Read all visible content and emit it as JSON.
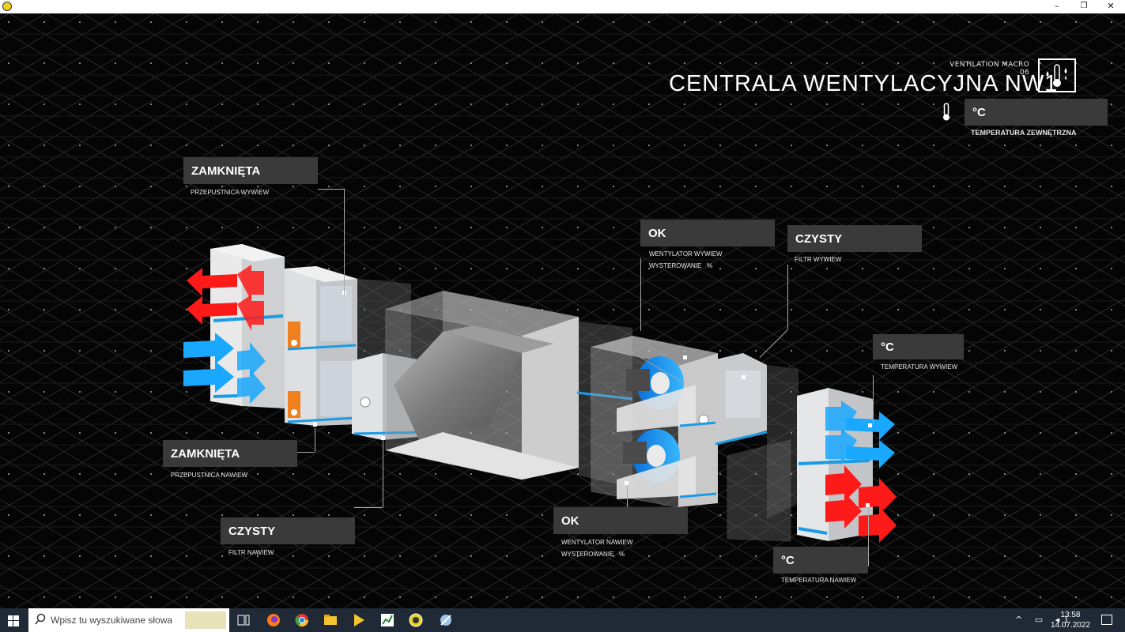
{
  "window": {
    "minimize": "–",
    "restore": "❐",
    "close": "✕"
  },
  "header": {
    "subtitle": "VENTILATION MACRO 06",
    "title": "CENTRALA WENTYLACYJNA NW1",
    "icon": "thermometer-droplets-icon"
  },
  "outdoor": {
    "value": "°C",
    "label": "TEMPERATURA ZEWNĘTRZNA",
    "icon": "thermometer-icon"
  },
  "labels": {
    "damper_exhaust": {
      "value": "ZAMKNIĘTA",
      "label": "PRZEPUSTNICA WYWIEW"
    },
    "damper_supply": {
      "value": "ZAMKNIĘTA",
      "label": "PRZEPUSTNICA NAWIEW"
    },
    "filter_supply": {
      "value": "CZYSTY",
      "label": "FILTR NAWIEW"
    },
    "fan_exhaust": {
      "value": "OK",
      "label": "WENTYLATOR WYWIEW",
      "control": "WYSTEROWANIE",
      "unit": "%"
    },
    "filter_exhaust": {
      "value": "CZYSTY",
      "label": "FILTR WYWIEW"
    },
    "temp_exhaust": {
      "value": "°C",
      "label": "TEMPERATURA WYWIEW"
    },
    "fan_supply": {
      "value": "OK",
      "label": "WENTYLATOR NAWIEW",
      "control": "WYSTEROWANIE",
      "unit": "%"
    },
    "temp_supply": {
      "value": "°C",
      "label": "TEMPERATURA NAWIEW"
    }
  },
  "colors": {
    "supply_air": "#1aa8ff",
    "exhaust_air": "#ff1a1a",
    "panel": "#3a3a3a"
  },
  "taskbar": {
    "search_placeholder": "Wpisz tu wyszukiwane słowa",
    "time": "13:58",
    "date": "14.07.2022"
  }
}
